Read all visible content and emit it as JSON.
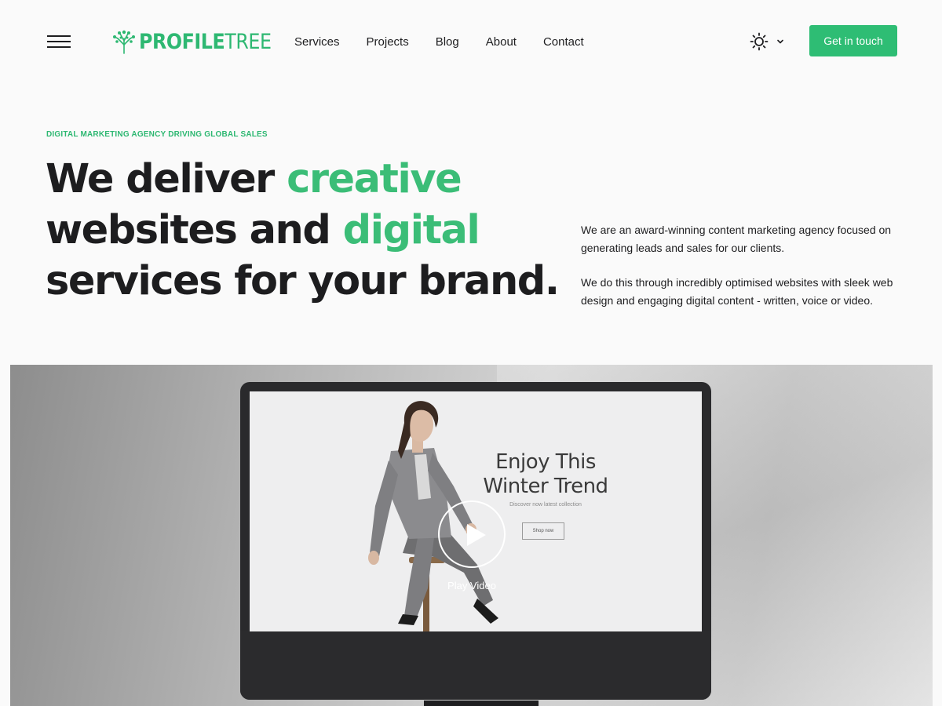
{
  "header": {
    "logo": {
      "bold": "PROFILE",
      "light": "TREE"
    },
    "nav": [
      {
        "label": "Services"
      },
      {
        "label": "Projects"
      },
      {
        "label": "Blog"
      },
      {
        "label": "About"
      },
      {
        "label": "Contact"
      }
    ],
    "theme_icon": "sun-icon",
    "cta_label": "Get in touch"
  },
  "hero": {
    "eyebrow": "DIGITAL MARKETING AGENCY DRIVING GLOBAL SALES",
    "headline": {
      "part1": "We deliver ",
      "hl1": "creative",
      "part2": "websites and ",
      "hl2": "digital",
      "part3": "services for your brand."
    },
    "description": [
      "We are an award-winning content marketing agency focused on generating leads and sales for our clients.",
      "We do this through incredibly optimised websites with sleek web design and engaging digital content - written, voice or video."
    ]
  },
  "media": {
    "promo_title_line1": "Enjoy This",
    "promo_title_line2": "Winter Trend",
    "promo_subtitle": "Discover now latest collection",
    "promo_button": "Shop now",
    "play_label": "Play Video"
  },
  "colors": {
    "accent": "#2eb872",
    "cta": "#2ebd74",
    "text": "#1d1d1f",
    "background": "#fafafa"
  }
}
